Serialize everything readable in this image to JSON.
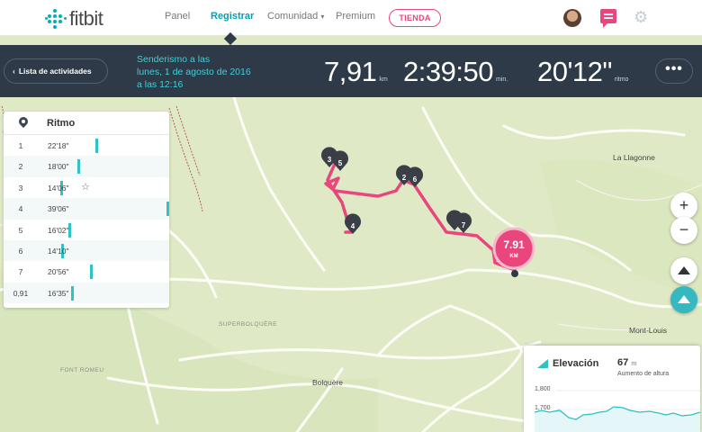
{
  "header": {
    "logo_text": "fitbit",
    "nav": [
      "Panel",
      "Registrar",
      "Comunidad",
      "Premium"
    ],
    "comunidad_caret": "▾",
    "store_label": "TIENDA",
    "accent": "#00a1b1",
    "brand_pink": "#e8467c"
  },
  "activity": {
    "back_label": "Lista de actividades",
    "back_chevron": "‹",
    "title_lines": [
      "Senderismo a las",
      "lunes, 1 de agosto de 2016",
      "a las 12:16"
    ],
    "distance": "7,91",
    "distance_unit": "km",
    "duration": "2:39:50",
    "duration_unit": "min.",
    "pace": "20'12\"",
    "pace_unit": "ritmo",
    "more_label": "•••"
  },
  "splits": {
    "title": "Ritmo",
    "max_pace_seconds": 2346,
    "rows": [
      {
        "lap": "1",
        "pace": "22'18\"",
        "seconds": 1338
      },
      {
        "lap": "2",
        "pace": "18'00\"",
        "seconds": 1080
      },
      {
        "lap": "3",
        "pace": "14'06\"",
        "seconds": 846,
        "best": true
      },
      {
        "lap": "4",
        "pace": "39'06\"",
        "seconds": 2346
      },
      {
        "lap": "5",
        "pace": "16'02\"",
        "seconds": 962
      },
      {
        "lap": "6",
        "pace": "14'10\"",
        "seconds": 850
      },
      {
        "lap": "7",
        "pace": "20'56\"",
        "seconds": 1256
      },
      {
        "lap": "0,91",
        "pace": "16'35\"",
        "seconds": 995
      }
    ]
  },
  "map": {
    "end_badge_value": "7.91",
    "end_badge_unit": "KM",
    "markers": [
      "3",
      "5",
      "2",
      "6",
      "4",
      "7"
    ],
    "places": {
      "la_llagonne": "La Llagonne",
      "mont_louis": "Mont-Louis",
      "superbolquere": "SUPERBOLQUÈRE",
      "bolquere": "Bolquère",
      "font_romeu": "FONT ROMEU"
    },
    "controls": {
      "zoom_in": "+",
      "zoom_out": "−"
    }
  },
  "elevation": {
    "title": "Elevación",
    "value": "67",
    "unit": "m",
    "subtitle": "Aumento de altura",
    "ticks": [
      "1,800",
      "1,700"
    ]
  },
  "colors": {
    "route": "#e8467c",
    "teal": "#2ec1c5",
    "navy": "#2e3a48"
  }
}
